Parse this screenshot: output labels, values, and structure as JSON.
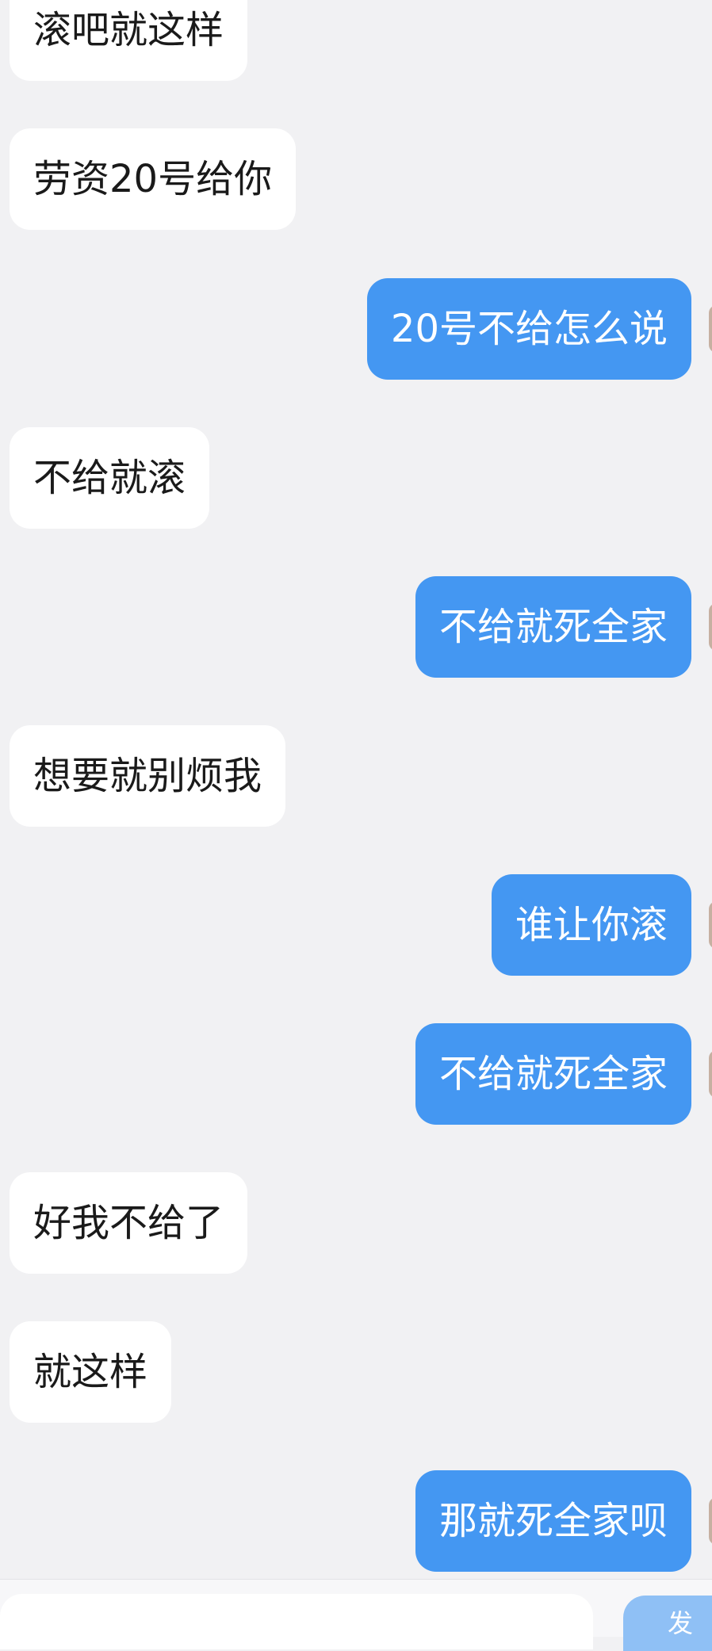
{
  "messages": [
    {
      "direction": "incoming",
      "text": "滚吧就这样"
    },
    {
      "direction": "incoming",
      "text": "劳资20号给你"
    },
    {
      "direction": "outgoing",
      "text": "20号不给怎么说"
    },
    {
      "direction": "incoming",
      "text": "不给就滚"
    },
    {
      "direction": "outgoing",
      "text": "不给就死全家"
    },
    {
      "direction": "incoming",
      "text": "想要就别烦我"
    },
    {
      "direction": "outgoing",
      "text": "谁让你滚"
    },
    {
      "direction": "outgoing",
      "text": "不给就死全家"
    },
    {
      "direction": "incoming",
      "text": "好我不给了"
    },
    {
      "direction": "incoming",
      "text": "就这样"
    },
    {
      "direction": "outgoing",
      "text": "那就死全家呗"
    }
  ],
  "composer": {
    "send_label": "发"
  },
  "colors": {
    "background": "#f1f1f3",
    "incoming_bubble": "#ffffff",
    "outgoing_bubble": "#4497f2",
    "send_button": "#8fc0f5"
  }
}
